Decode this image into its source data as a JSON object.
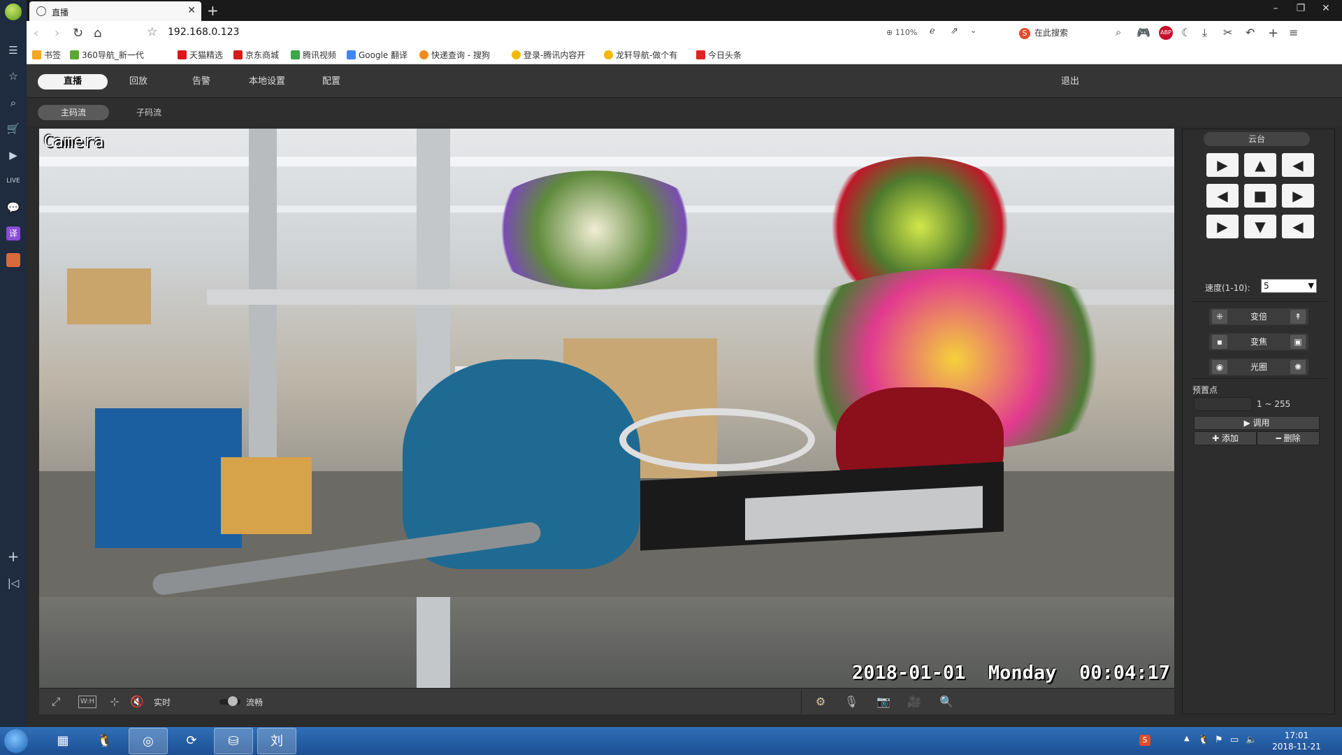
{
  "browser": {
    "tab_title": "直播",
    "url": "192.168.0.123",
    "zoom": "110%",
    "search_placeholder": "在此搜索",
    "bookmarks": [
      {
        "label": "书签",
        "color": "#f5a623"
      },
      {
        "label": "360导航_新一代",
        "color": "#5aa833"
      },
      {
        "label": "天猫精选",
        "color": "#e0121b"
      },
      {
        "label": "京东商城",
        "color": "#d71c1c"
      },
      {
        "label": "腾讯视频",
        "color": "#3aa845"
      },
      {
        "label": "Google 翻译",
        "color": "#4285f4"
      },
      {
        "label": "快递查询 - 搜狗",
        "color": "#f08c1e"
      },
      {
        "label": "登录-腾讯内容开",
        "color": "#f5b800"
      },
      {
        "label": "龙轩导航-做个有",
        "color": "#f5b800"
      },
      {
        "label": "今日头条",
        "color": "#e02424"
      }
    ]
  },
  "app": {
    "menu": [
      "直播",
      "回放",
      "告警",
      "本地设置",
      "配置"
    ],
    "logout": "退出",
    "streams": [
      "主码流",
      "子码流"
    ],
    "video": {
      "osd_camera": "Camera",
      "osd_datetime": "2018-01-01  Monday  00:04:17"
    },
    "toolbar": {
      "realtime_label": "实时",
      "smooth_label": "流畅"
    },
    "ptz": {
      "title": "云台",
      "speed_label": "速度(1-10):",
      "speed_value": "5",
      "zoom_label": "变倍",
      "focus_label": "变焦",
      "iris_label": "光圈",
      "preset_label": "预置点",
      "preset_range": "1 ~ 255",
      "call_button": "▶ 调用",
      "add_button": "✚ 添加",
      "delete_button": "━ 删除"
    }
  },
  "taskbar": {
    "time": "17:01",
    "date": "2018-11-21"
  }
}
